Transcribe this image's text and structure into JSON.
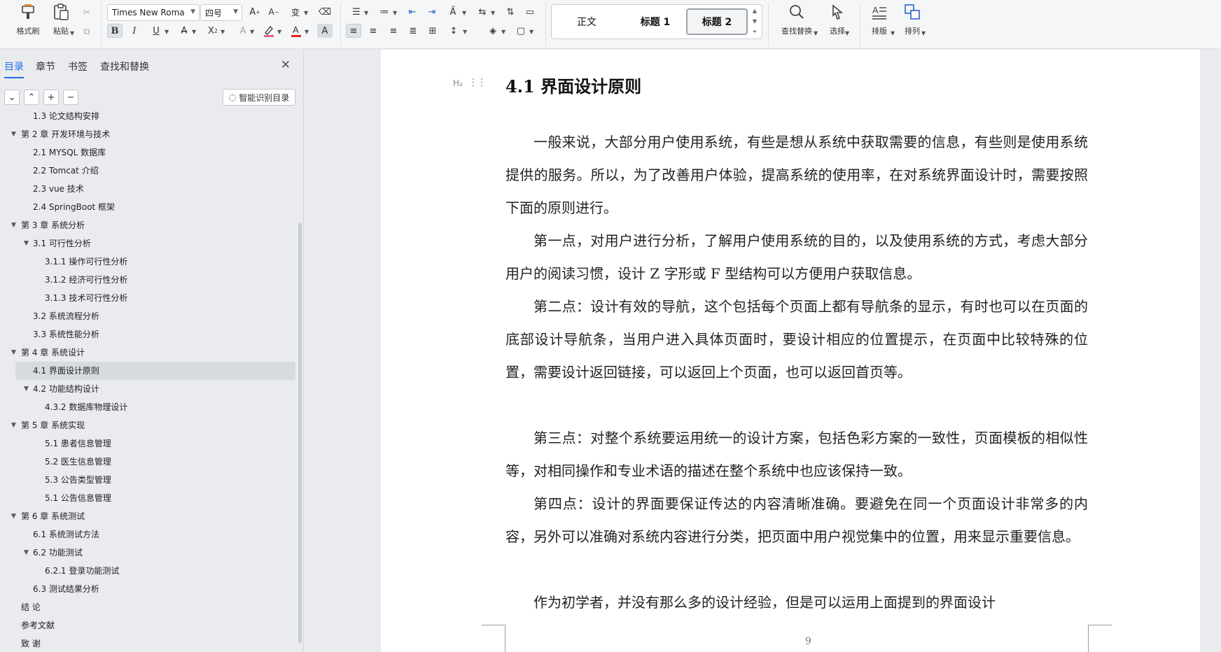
{
  "ribbon": {
    "format_painter": "格式刷",
    "paste": "粘贴",
    "font_family": "Times New Roma",
    "font_size": "四号",
    "styles": [
      "正文",
      "标题 1",
      "标题 2"
    ],
    "find_replace": "查找替换",
    "select": "选择",
    "typeset": "排版",
    "arrange": "排列"
  },
  "nav": {
    "tabs": [
      "目录",
      "章节",
      "书签",
      "查找和替换"
    ],
    "smart_toc": "智能识别目录",
    "items": [
      {
        "label": "1.3 论文结构安排",
        "level": 2
      },
      {
        "label": "第 2 章  开发环境与技术",
        "level": 1
      },
      {
        "label": "2.1 MYSQL 数据库",
        "level": 2
      },
      {
        "label": "2.2 Tomcat  介绍",
        "level": 2
      },
      {
        "label": "2.3 vue 技术",
        "level": 2
      },
      {
        "label": "2.4 SpringBoot 框架",
        "level": 2
      },
      {
        "label": "第 3 章  系统分析",
        "level": 1
      },
      {
        "label": "3.1 可行性分析",
        "level": 2
      },
      {
        "label": "3.1.1 操作可行性分析",
        "level": 3
      },
      {
        "label": "3.1.2 经济可行性分析",
        "level": 3
      },
      {
        "label": "3.1.3 技术可行性分析",
        "level": 3
      },
      {
        "label": "3.2 系统流程分析",
        "level": 2
      },
      {
        "label": "3.3 系统性能分析",
        "level": 2
      },
      {
        "label": "第 4 章  系统设计",
        "level": 1
      },
      {
        "label": "4.1 界面设计原则",
        "level": 2
      },
      {
        "label": "4.2 功能结构设计",
        "level": 2
      },
      {
        "label": "4.3.2  数据库物理设计",
        "level": 3
      },
      {
        "label": "第 5 章  系统实现",
        "level": 1
      },
      {
        "label": "5.1 患者信息管理",
        "level": 3
      },
      {
        "label": "5.2  医生信息管理",
        "level": 3
      },
      {
        "label": "5.3 公告类型管理",
        "level": 3
      },
      {
        "label": "5.1 公告信息管理",
        "level": 3
      },
      {
        "label": "第 6 章  系统测试",
        "level": 1
      },
      {
        "label": "6.1  系统测试方法",
        "level": 2
      },
      {
        "label": "6.2  功能测试",
        "level": 2
      },
      {
        "label": "6.2.1  登录功能测试",
        "level": 3
      },
      {
        "label": "6.3  测试结果分析",
        "level": 2
      },
      {
        "label": "结   论",
        "level": 1
      },
      {
        "label": "参考文献",
        "level": 1
      },
      {
        "label": "致   谢",
        "level": 1
      }
    ]
  },
  "document": {
    "heading": "4.1 界面设计原则",
    "heading_marker": "H₂",
    "paragraphs": [
      "一般来说，大部分用户使用系统，有些是想从系统中获取需要的信息，有些则是使用系统提供的服务。所以，为了改善用户体验，提高系统的使用率，在对系统界面设计时，需要按照下面的原则进行。",
      "第一点，对用户进行分析，了解用户使用系统的目的，以及使用系统的方式，考虑大部分用户的阅读习惯，设计 Z 字形或 F 型结构可以方便用户获取信息。",
      "第二点：设计有效的导航，这个包括每个页面上都有导航条的显示，有时也可以在页面的底部设计导航条，当用户进入具体页面时，要设计相应的位置提示，在页面中比较特殊的位置，需要设计返回链接，可以返回上个页面，也可以返回首页等。",
      "第三点：对整个系统要运用统一的设计方案，包括色彩方案的一致性，页面模板的相似性等，对相同操作和专业术语的描述在整个系统中也应该保持一致。",
      "第四点：设计的界面要保证传达的内容清晰准确。要避免在同一个页面设计非常多的内容，另外可以准确对系统内容进行分类，把页面中用户视觉集中的位置，用来显示重要信息。",
      "作为初学者，并没有那么多的设计经验，但是可以运用上面提到的界面设计"
    ],
    "page_number": "9"
  },
  "colors": {
    "accent": "#1f6fe5",
    "page": "#ffffff",
    "workspace": "#e9ebee"
  }
}
